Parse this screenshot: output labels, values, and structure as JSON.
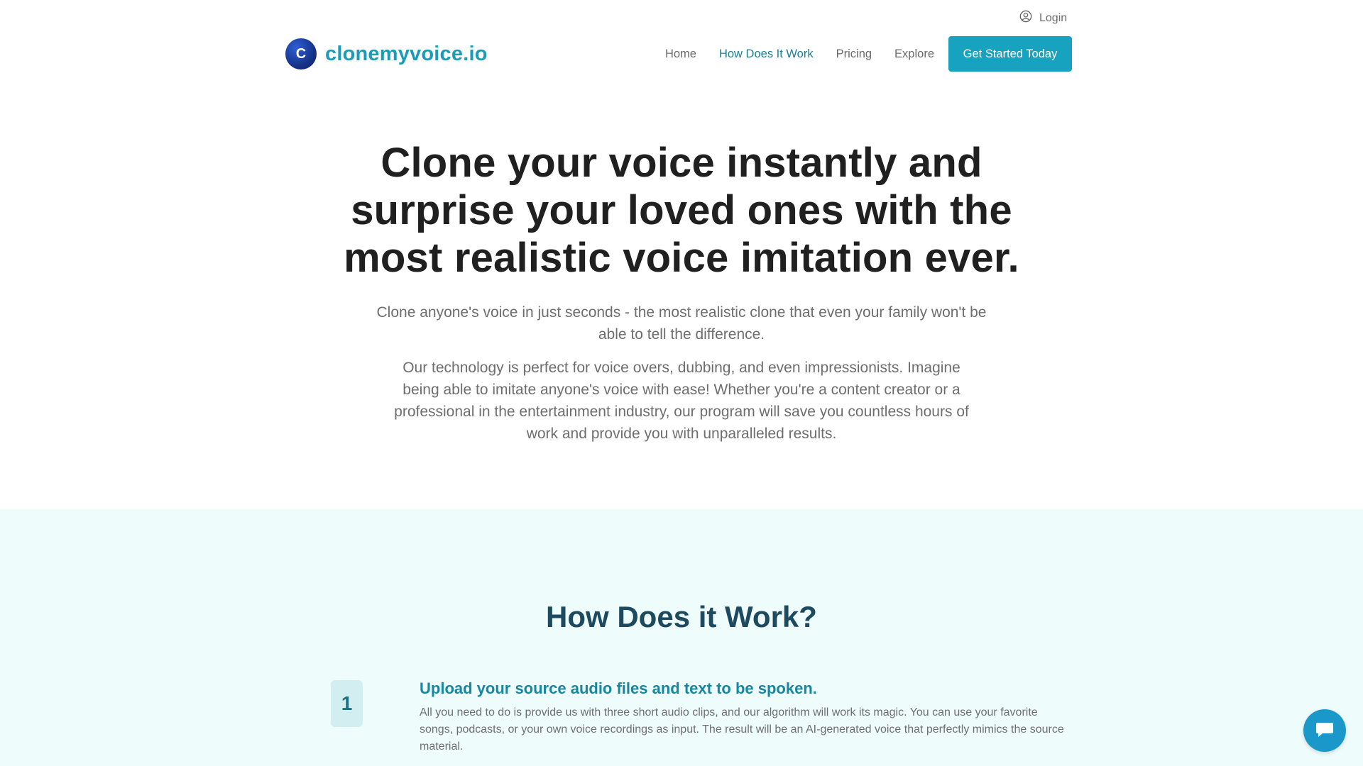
{
  "topbar": {
    "login_label": "Login",
    "login_icon": "user-circle-icon"
  },
  "brand": {
    "logo_letter": "C",
    "name": "clonemyvoice.io",
    "accent": "#1a9cb8"
  },
  "nav": {
    "items": [
      {
        "label": "Home",
        "active": false
      },
      {
        "label": "How Does It Work",
        "active": true
      },
      {
        "label": "Pricing",
        "active": false
      },
      {
        "label": "Explore",
        "active": false
      }
    ],
    "cta_label": "Get Started Today",
    "cta_color": "#17a2bf"
  },
  "hero": {
    "title": "Clone your voice instantly and surprise your loved ones with the most realistic voice imitation ever.",
    "subtitle": "Clone anyone's voice in just seconds - the most realistic clone that even your family won't be able to tell the difference.",
    "body": "Our technology is perfect for voice overs, dubbing, and even impressionists. Imagine being able to imitate anyone's voice with ease! Whether you're a content creator or a professional in the entertainment industry, our program will save you countless hours of work and provide you with unparalleled results."
  },
  "how": {
    "heading": "How Does it Work?",
    "background": "#eefcfc",
    "steps": [
      {
        "number": "1",
        "title": "Upload your source audio files and text to be spoken.",
        "description": "All you need to do is provide us with three short audio clips, and our algorithm will work its magic. You can use your favorite songs, podcasts, or your own voice recordings as input. The result will be an AI-generated voice that perfectly mimics the source material."
      }
    ]
  },
  "chat_widget": {
    "icon": "chat-bubble-icon",
    "color": "#1a98c9"
  }
}
